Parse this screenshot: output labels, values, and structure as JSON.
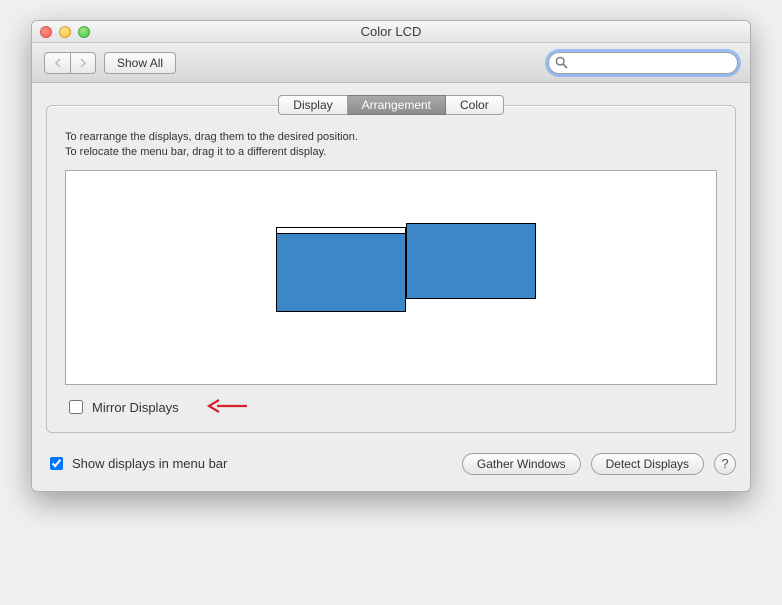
{
  "window": {
    "title": "Color LCD"
  },
  "toolbar": {
    "show_all_label": "Show All",
    "search_placeholder": ""
  },
  "tabs": [
    {
      "label": "Display",
      "active": false
    },
    {
      "label": "Arrangement",
      "active": true
    },
    {
      "label": "Color",
      "active": false
    }
  ],
  "panel": {
    "instruction_line1": "To rearrange the displays, drag them to the desired position.",
    "instruction_line2": "To relocate the menu bar, drag it to a different display.",
    "mirror_label": "Mirror Displays",
    "mirror_checked": false
  },
  "footer": {
    "show_in_menu_bar_label": "Show displays in menu bar",
    "show_in_menu_bar_checked": true,
    "gather_label": "Gather Windows",
    "detect_label": "Detect Displays",
    "help_label": "?"
  },
  "annotation": {
    "arrow_color": "#d2232a"
  }
}
